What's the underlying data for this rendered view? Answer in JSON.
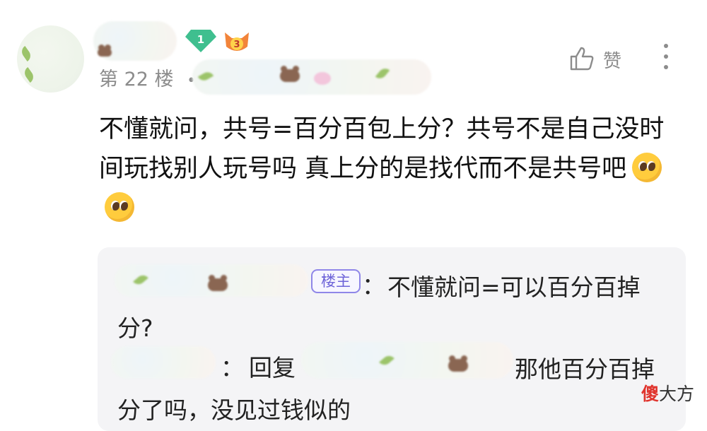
{
  "comment": {
    "floor_label": "第 22 楼",
    "floor_separator": "•",
    "text": "不懂就问，共号=百分百包上分？共号不是自己没时间玩找别人玩号吗 真上分的是找代而不是共号吧",
    "emojis": [
      "pleading-face-emoji",
      "pleading-face-emoji"
    ],
    "badges": {
      "level": "1",
      "extra": "3"
    },
    "like_label": "赞"
  },
  "replies": [
    {
      "badge": "楼主",
      "separator": "：",
      "text": "不懂就问=可以百分百掉分?"
    },
    {
      "separator": "：",
      "prefix": "回复",
      "text": "那他百分百掉分了吗，没见过钱似的"
    }
  ],
  "watermark": {
    "char1": "傻",
    "rest": "大方"
  },
  "colors": {
    "badge_outline": "#8f86e8",
    "level_badge": "#3fbf8f",
    "extra_badge": "#f2843a",
    "watermark_red": "#e0342d"
  }
}
